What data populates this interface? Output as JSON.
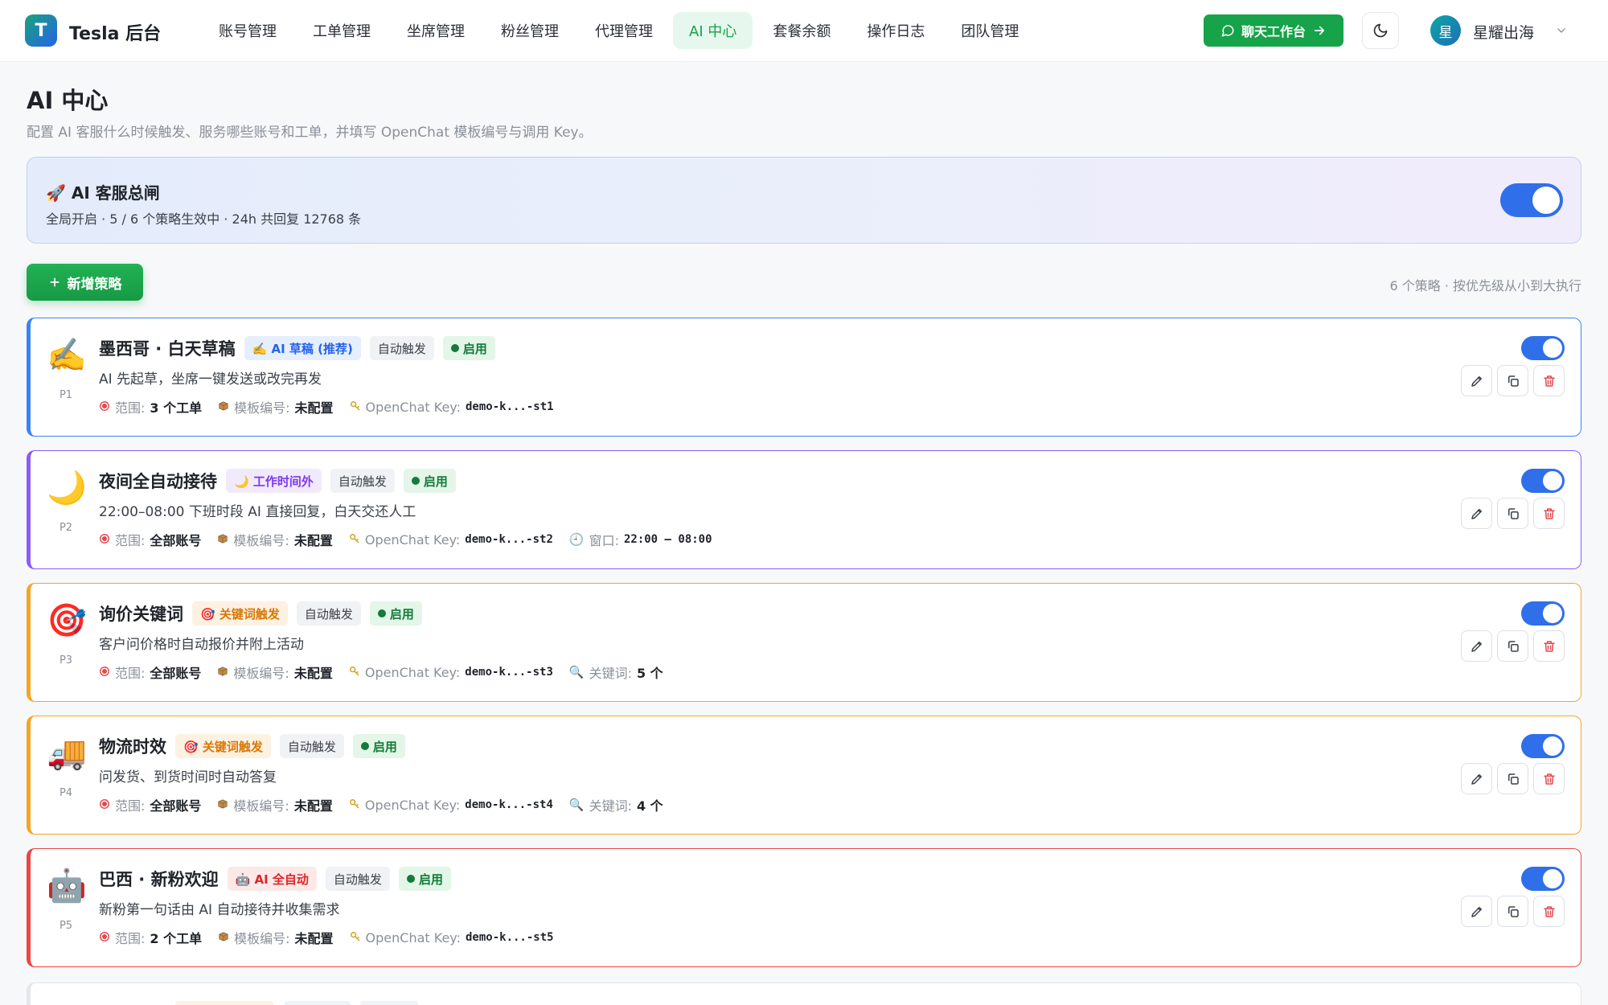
{
  "app": {
    "logo_letter": "T",
    "brand": "Tesla 后台",
    "nav": [
      {
        "label": "账号管理",
        "active": false
      },
      {
        "label": "工单管理",
        "active": false
      },
      {
        "label": "坐席管理",
        "active": false
      },
      {
        "label": "粉丝管理",
        "active": false
      },
      {
        "label": "代理管理",
        "active": false
      },
      {
        "label": "AI 中心",
        "active": true
      },
      {
        "label": "套餐余额",
        "active": false
      },
      {
        "label": "操作日志",
        "active": false
      },
      {
        "label": "团队管理",
        "active": false
      }
    ],
    "chat_button": "聊天工作台",
    "user": {
      "avatar_letter": "星",
      "name": "星耀出海"
    }
  },
  "header": {
    "title": "AI 中心",
    "subtitle": "配置 AI 客服什么时候触发、服务哪些账号和工单，并填写 OpenChat 模板编号与调用 Key。"
  },
  "master": {
    "emoji": "🚀",
    "title": "AI 客服总闸",
    "desc": "全局开启 · 5 / 6 个策略生效中 · 24h 共回复 12768 条",
    "enabled": true
  },
  "toolbar": {
    "add_label": "新增策略",
    "list_meta": "6 个策略 · 按优先级从小到大执行"
  },
  "labels": {
    "scope": "范围:",
    "template": "模板编号:",
    "key": "OpenChat Key:",
    "window": "窗口:",
    "keywords": "关键词:"
  },
  "colors": {
    "accent_green": "#16a34a",
    "toggle_blue": "#2f6fea",
    "delete_red": "#e5484d"
  },
  "strategies": [
    {
      "icon": "✍️",
      "priority": "P1",
      "name": "墨西哥 · 白天草稿",
      "mode_label": "✍️ AI 草稿 (推荐)",
      "mode_color": "#2563eb",
      "mode_bg": "#e6effd",
      "border_color": "#3b82f6",
      "trigger": "自动触发",
      "status": "启用",
      "desc": "AI 先起草，坐席一键发送或改完再发",
      "scope": "3 个工单",
      "template": "未配置",
      "key": "demo-k...-st1",
      "extra_label": "",
      "extra_value": "",
      "extra_emoji": "",
      "extra_mono": false
    },
    {
      "icon": "🌙",
      "priority": "P2",
      "name": "夜间全自动接待",
      "mode_label": "🌙 工作时间外",
      "mode_color": "#7c3aed",
      "mode_bg": "#f1eafd",
      "border_color": "#8b5cf6",
      "trigger": "自动触发",
      "status": "启用",
      "desc": "22:00–08:00 下班时段 AI 直接回复，白天交还人工",
      "scope": "全部账号",
      "template": "未配置",
      "key": "demo-k...-st2",
      "extra_label": "窗口:",
      "extra_value": "22:00 – 08:00",
      "extra_emoji": "🕘",
      "extra_mono": true
    },
    {
      "icon": "🎯",
      "priority": "P3",
      "name": "询价关键词",
      "mode_label": "🎯 关键词触发",
      "mode_color": "#d97706",
      "mode_bg": "#fdf1e2",
      "border_color": "#f5a524",
      "trigger": "自动触发",
      "status": "启用",
      "desc": "客户问价格时自动报价并附上活动",
      "scope": "全部账号",
      "template": "未配置",
      "key": "demo-k...-st3",
      "extra_label": "关键词:",
      "extra_value": "5 个",
      "extra_emoji": "🔍",
      "extra_mono": false
    },
    {
      "icon": "🚚",
      "priority": "P4",
      "name": "物流时效",
      "mode_label": "🎯 关键词触发",
      "mode_color": "#d97706",
      "mode_bg": "#fdf1e2",
      "border_color": "#f5a524",
      "trigger": "自动触发",
      "status": "启用",
      "desc": "问发货、到货时间时自动答复",
      "scope": "全部账号",
      "template": "未配置",
      "key": "demo-k...-st4",
      "extra_label": "关键词:",
      "extra_value": "4 个",
      "extra_emoji": "🔍",
      "extra_mono": false
    },
    {
      "icon": "🤖",
      "priority": "P5",
      "name": "巴西 · 新粉欢迎",
      "mode_label": "🤖 AI 全自动",
      "mode_color": "#dc2626",
      "mode_bg": "#fde8e8",
      "border_color": "#ef4444",
      "trigger": "自动触发",
      "status": "启用",
      "desc": "新粉第一句话由 AI 自动接待并收集需求",
      "scope": "2 个工单",
      "template": "未配置",
      "key": "demo-k...-st5",
      "extra_label": "",
      "extra_value": "",
      "extra_emoji": "",
      "extra_mono": false
    }
  ]
}
